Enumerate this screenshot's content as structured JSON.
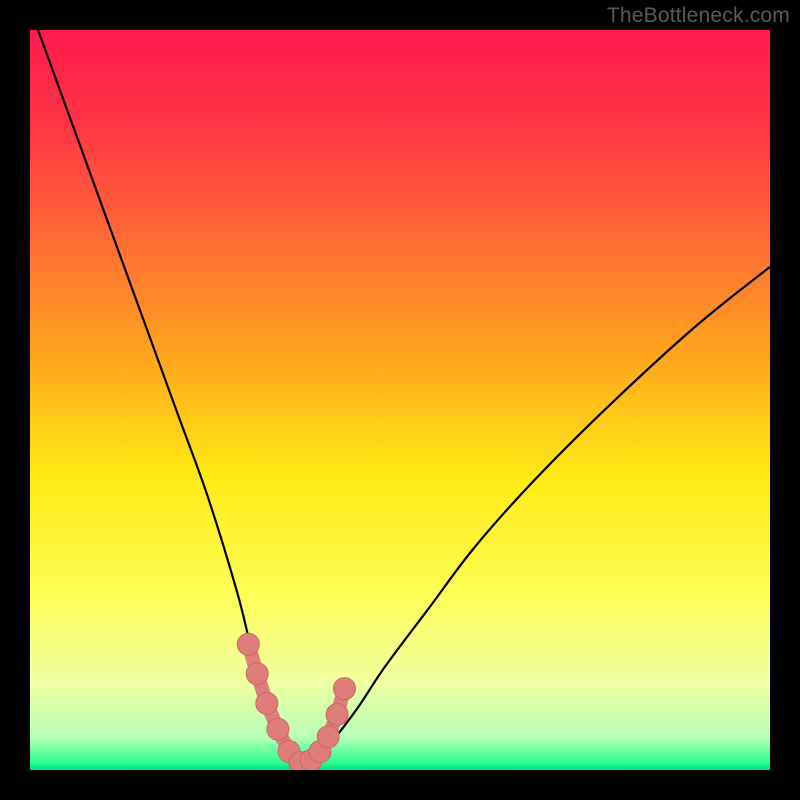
{
  "watermark": "TheBottleneck.com",
  "colors": {
    "frame": "#000000",
    "curve_stroke": "#000000",
    "marker_fill": "#df7d7a",
    "marker_stroke": "#c96763",
    "gradient_stops": [
      {
        "offset": 0.0,
        "color": "#ff1a4f"
      },
      {
        "offset": 0.12,
        "color": "#ff3246"
      },
      {
        "offset": 0.28,
        "color": "#ff6a35"
      },
      {
        "offset": 0.44,
        "color": "#ffa41e"
      },
      {
        "offset": 0.6,
        "color": "#ffe913"
      },
      {
        "offset": 0.76,
        "color": "#fefe56"
      },
      {
        "offset": 0.88,
        "color": "#f1ffa0"
      },
      {
        "offset": 0.955,
        "color": "#b8ffb8"
      },
      {
        "offset": 0.99,
        "color": "#2bff90"
      },
      {
        "offset": 1.0,
        "color": "#00dd88"
      }
    ]
  },
  "chart_data": {
    "type": "line",
    "title": "",
    "xlabel": "",
    "ylabel": "",
    "ylim": [
      0,
      100
    ],
    "xlim": [
      0,
      100
    ],
    "series": [
      {
        "name": "bottleneck-curve",
        "x": [
          0,
          4,
          8,
          12,
          16,
          20,
          24,
          28,
          30,
          32,
          34,
          35.5,
          37,
          40,
          44,
          48,
          54,
          60,
          68,
          78,
          90,
          100
        ],
        "y": [
          103,
          92,
          81,
          70,
          59,
          48,
          37,
          24,
          16,
          9,
          3.5,
          1.2,
          1.2,
          3,
          8,
          14,
          22,
          30,
          39,
          49,
          60,
          68
        ]
      }
    ],
    "markers": {
      "name": "highlighted-points",
      "x": [
        29.5,
        30.7,
        32.0,
        33.5,
        35.0,
        36.5,
        38.0,
        39.2,
        40.3,
        41.5,
        42.5
      ],
      "y": [
        17.0,
        13.0,
        9.0,
        5.5,
        2.5,
        1.0,
        1.3,
        2.5,
        4.5,
        7.5,
        11.0
      ]
    }
  }
}
